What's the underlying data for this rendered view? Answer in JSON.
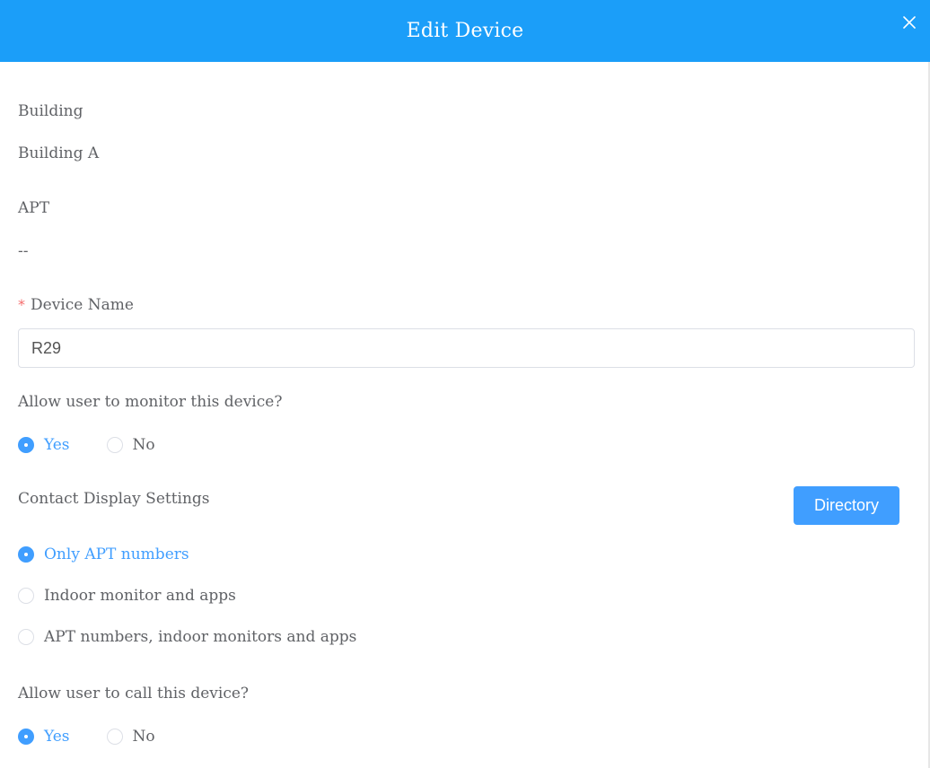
{
  "dialog": {
    "title": "Edit Device",
    "close_icon": "close-icon"
  },
  "building": {
    "label": "Building",
    "value": "Building A"
  },
  "apt": {
    "label": "APT",
    "value": "--"
  },
  "device_name": {
    "required_mark": "*",
    "label": "Device Name",
    "value": "R29"
  },
  "monitor": {
    "label": "Allow user to monitor this device?",
    "options": [
      {
        "label": "Yes",
        "checked": true
      },
      {
        "label": "No",
        "checked": false
      }
    ]
  },
  "contact_display": {
    "label": "Contact Display Settings",
    "directory_button": "Directory",
    "options": [
      {
        "label": "Only APT numbers",
        "checked": true
      },
      {
        "label": "Indoor monitor and apps",
        "checked": false
      },
      {
        "label": "APT numbers, indoor monitors and apps",
        "checked": false
      }
    ]
  },
  "call": {
    "label": "Allow user to call this device?",
    "options": [
      {
        "label": "Yes",
        "checked": true
      },
      {
        "label": "No",
        "checked": false
      }
    ]
  },
  "colors": {
    "header_bg": "#1b9ef9",
    "accent": "#409eff",
    "text": "#606266",
    "required": "#f56c6c"
  }
}
